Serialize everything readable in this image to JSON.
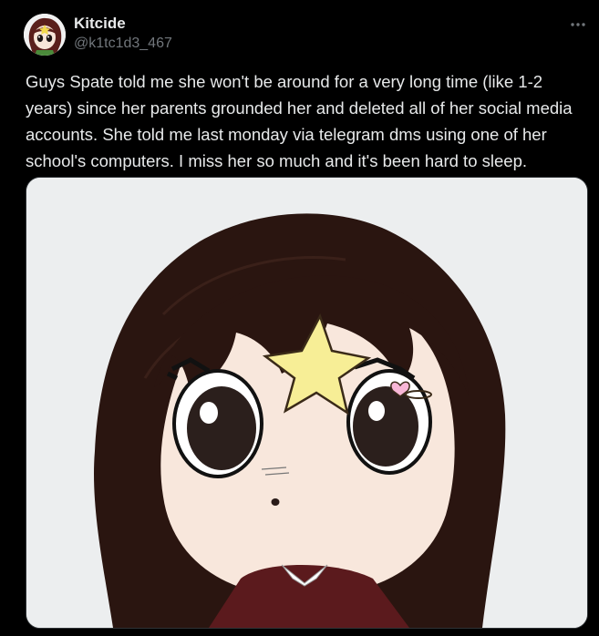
{
  "post": {
    "author": {
      "display_name": "Kitcide",
      "handle": "@k1tc1d3_467"
    },
    "more_icon": "ellipsis-horizontal-icon",
    "text": "Guys Spate told me she won't be around for a very long time (like 1-2 years) since her parents grounded her and deleted all of her social media accounts. She told me last monday via telegram dms using one of her school's computers. I miss her so much and it's been hard to sleep.",
    "media": {
      "type": "image",
      "subject": "drawn-character-portrait"
    }
  },
  "theme": {
    "background": "#000000",
    "text_primary": "#e7e9ea",
    "text_secondary": "#71767b",
    "border": "#2f3336"
  }
}
